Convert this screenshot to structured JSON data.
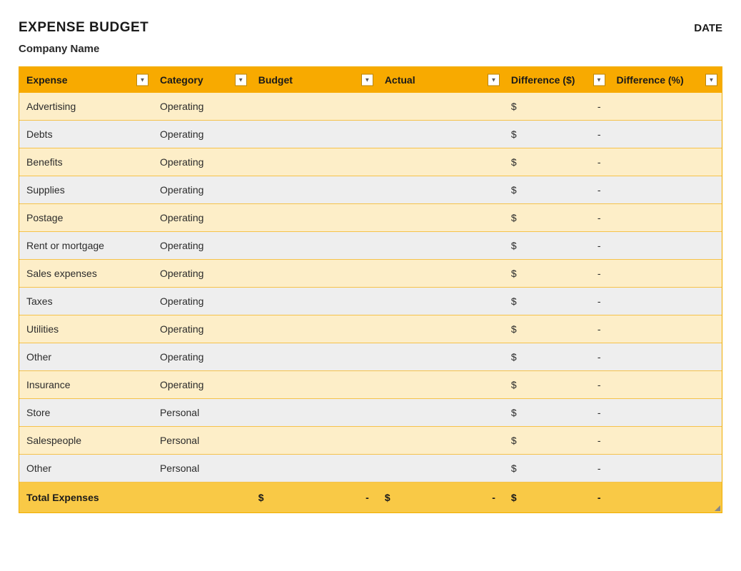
{
  "header": {
    "title": "EXPENSE BUDGET",
    "date_label": "DATE",
    "subtitle": "Company Name"
  },
  "columns": [
    {
      "label": "Expense"
    },
    {
      "label": "Category"
    },
    {
      "label": "Budget"
    },
    {
      "label": "Actual"
    },
    {
      "label": "Difference ($)"
    },
    {
      "label": "Difference (%)"
    }
  ],
  "rows": [
    {
      "expense": "Advertising",
      "category": "Operating",
      "budget": "",
      "actual": "",
      "diff_d": "$",
      "diff_p": "-"
    },
    {
      "expense": "Debts",
      "category": "Operating",
      "budget": "",
      "actual": "",
      "diff_d": "$",
      "diff_p": "-"
    },
    {
      "expense": "Benefits",
      "category": "Operating",
      "budget": "",
      "actual": "",
      "diff_d": "$",
      "diff_p": "-"
    },
    {
      "expense": "Supplies",
      "category": "Operating",
      "budget": "",
      "actual": "",
      "diff_d": "$",
      "diff_p": "-"
    },
    {
      "expense": "Postage",
      "category": "Operating",
      "budget": "",
      "actual": "",
      "diff_d": "$",
      "diff_p": "-"
    },
    {
      "expense": "Rent or mortgage",
      "category": "Operating",
      "budget": "",
      "actual": "",
      "diff_d": "$",
      "diff_p": "-"
    },
    {
      "expense": "Sales expenses",
      "category": "Operating",
      "budget": "",
      "actual": "",
      "diff_d": "$",
      "diff_p": "-"
    },
    {
      "expense": "Taxes",
      "category": "Operating",
      "budget": "",
      "actual": "",
      "diff_d": "$",
      "diff_p": "-"
    },
    {
      "expense": "Utilities",
      "category": "Operating",
      "budget": "",
      "actual": "",
      "diff_d": "$",
      "diff_p": "-"
    },
    {
      "expense": "Other",
      "category": "Operating",
      "budget": "",
      "actual": "",
      "diff_d": "$",
      "diff_p": "-"
    },
    {
      "expense": "Insurance",
      "category": "Operating",
      "budget": "",
      "actual": "",
      "diff_d": "$",
      "diff_p": "-"
    },
    {
      "expense": "Store",
      "category": "Personal",
      "budget": "",
      "actual": "",
      "diff_d": "$",
      "diff_p": "-"
    },
    {
      "expense": "Salespeople",
      "category": "Personal",
      "budget": "",
      "actual": "",
      "diff_d": "$",
      "diff_p": "-"
    },
    {
      "expense": "Other",
      "category": "Personal",
      "budget": "",
      "actual": "",
      "diff_d": "$",
      "diff_p": "-"
    }
  ],
  "totals": {
    "label": "Total Expenses",
    "budget_sym": "$",
    "budget_dash": "-",
    "actual_sym": "$",
    "actual_dash": "-",
    "diff_d_sym": "$",
    "diff_d_dash": "-",
    "diff_p": ""
  }
}
